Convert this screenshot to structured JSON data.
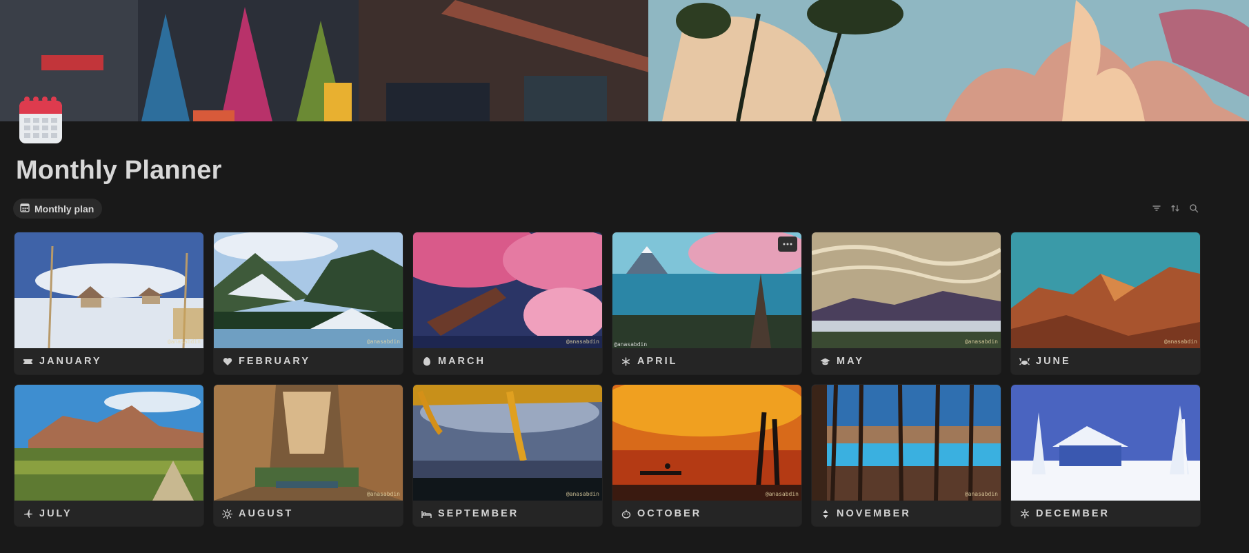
{
  "page": {
    "title": "Monthly Planner",
    "icon": "calendar-icon",
    "cover": "pixel-art-seaside-cover"
  },
  "view_tab": {
    "label": "Monthly plan",
    "icon": "calendar-grid-icon"
  },
  "toolbar": {
    "filter_icon": "filter-icon",
    "sort_icon": "sort-icon",
    "search_icon": "search-icon"
  },
  "card_menu_icon": "more-horizontal-icon",
  "credit": "@anasabdin",
  "months": [
    {
      "label": "JANUARY",
      "icon": "ticket-icon"
    },
    {
      "label": "FEBRUARY",
      "icon": "heart-icon"
    },
    {
      "label": "MARCH",
      "icon": "egg-icon"
    },
    {
      "label": "APRIL",
      "icon": "asterisk-icon"
    },
    {
      "label": "MAY",
      "icon": "graduation-cap-icon"
    },
    {
      "label": "JUNE",
      "icon": "crab-icon"
    },
    {
      "label": "JULY",
      "icon": "airplane-icon"
    },
    {
      "label": "AUGUST",
      "icon": "sun-icon"
    },
    {
      "label": "SEPTEMBER",
      "icon": "bed-icon"
    },
    {
      "label": "OCTOBER",
      "icon": "pumpkin-icon"
    },
    {
      "label": "NOVEMBER",
      "icon": "turkey-icon"
    },
    {
      "label": "DECEMBER",
      "icon": "snowflake-icon"
    }
  ]
}
